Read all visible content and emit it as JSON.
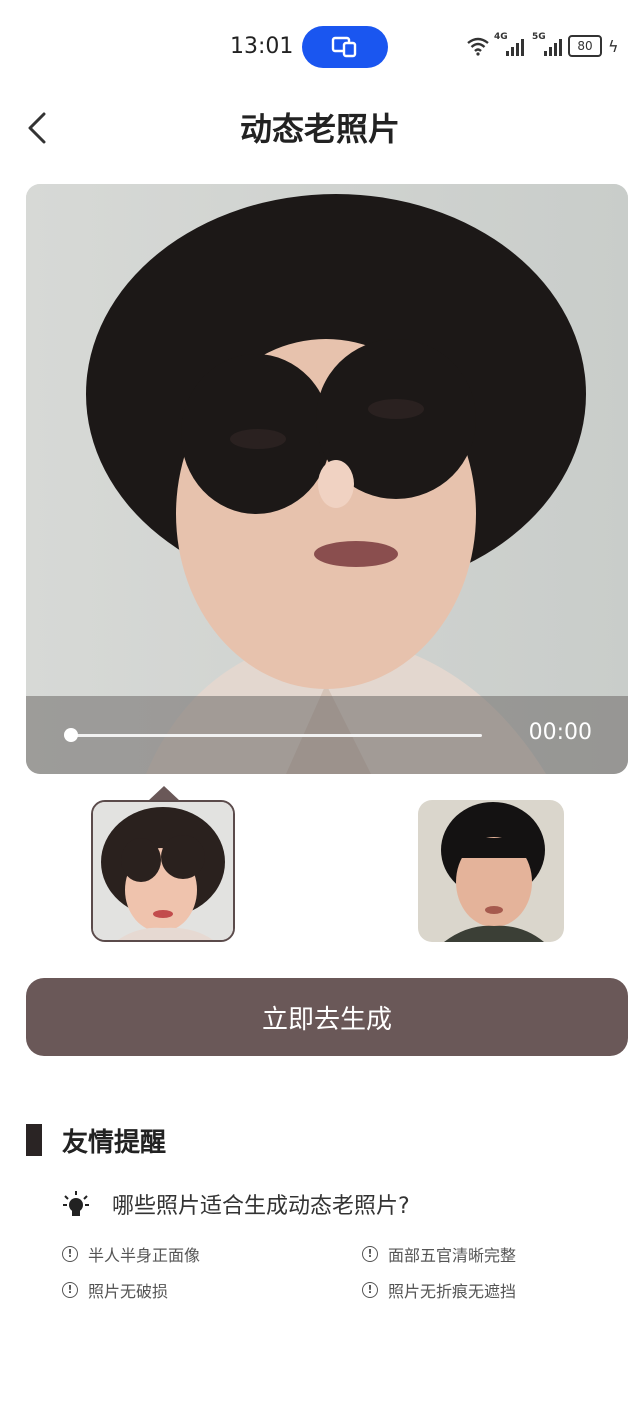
{
  "status_bar": {
    "time": "13:01",
    "battery": "80",
    "net1": "4G",
    "net2": "5G"
  },
  "header": {
    "title": "动态老照片"
  },
  "player": {
    "time": "00:00",
    "progress": 0
  },
  "thumbnails": [
    {
      "selected": true
    },
    {
      "selected": false
    }
  ],
  "cta": {
    "label": "立即去生成"
  },
  "tips": {
    "title": "友情提醒",
    "question": "哪些照片适合生成动态老照片?",
    "items": [
      "半人半身正面像",
      "面部五官清晰完整",
      "照片无破损",
      "照片无折痕无遮挡"
    ]
  },
  "colors": {
    "accent": "#6a5858",
    "pill": "#1a56f0",
    "dark_bar": "#2a2424"
  }
}
